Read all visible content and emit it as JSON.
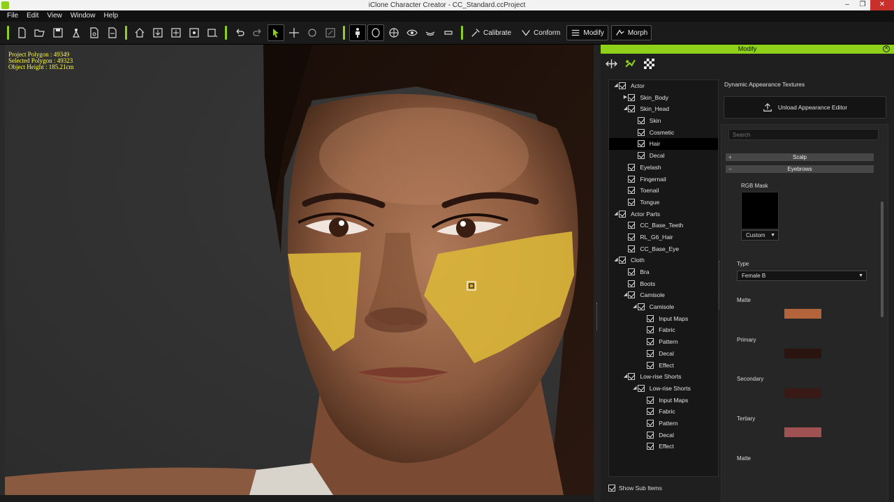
{
  "window": {
    "title": "iClone Character Creator - CC_Standard.ccProject"
  },
  "menu": [
    "File",
    "Edit",
    "View",
    "Window",
    "Help"
  ],
  "toolbar": {
    "calibrate": "Calibrate",
    "conform": "Conform",
    "modify": "Modify",
    "morph": "Morph"
  },
  "viewport": {
    "project_polygon": "Project Polygon : 49349",
    "selected_polygon": "Selected Polygon : 49323",
    "object_height": "Object Height : 185.21cm"
  },
  "panel": {
    "title": "Modify",
    "tree": [
      {
        "label": "Actor",
        "level": 0,
        "arrow": "open",
        "checked": true
      },
      {
        "label": "Skin_Body",
        "level": 1,
        "arrow": "closed",
        "checked": true
      },
      {
        "label": "Skin_Head",
        "level": 1,
        "arrow": "open",
        "checked": true
      },
      {
        "label": "Skin",
        "level": 2,
        "arrow": "",
        "checked": true
      },
      {
        "label": "Cosmetic",
        "level": 2,
        "arrow": "",
        "checked": true
      },
      {
        "label": "Hair",
        "level": 2,
        "arrow": "",
        "checked": true,
        "selected": true
      },
      {
        "label": "Decal",
        "level": 2,
        "arrow": "",
        "checked": true
      },
      {
        "label": "Eyelash",
        "level": 1,
        "arrow": "",
        "checked": true
      },
      {
        "label": "Fingernail",
        "level": 1,
        "arrow": "",
        "checked": true
      },
      {
        "label": "Toenail",
        "level": 1,
        "arrow": "",
        "checked": true
      },
      {
        "label": "Tongue",
        "level": 1,
        "arrow": "",
        "checked": true
      },
      {
        "label": "Actor Parts",
        "level": 0,
        "arrow": "open",
        "checked": true
      },
      {
        "label": "CC_Base_Teeth",
        "level": 1,
        "arrow": "",
        "checked": true
      },
      {
        "label": "RL_G6_Hair",
        "level": 1,
        "arrow": "",
        "checked": true
      },
      {
        "label": "CC_Base_Eye",
        "level": 1,
        "arrow": "",
        "checked": true
      },
      {
        "label": "Cloth",
        "level": 0,
        "arrow": "open",
        "checked": true
      },
      {
        "label": "Bra",
        "level": 1,
        "arrow": "",
        "checked": true
      },
      {
        "label": "Boots",
        "level": 1,
        "arrow": "",
        "checked": true
      },
      {
        "label": "Camisole",
        "level": 1,
        "arrow": "open",
        "checked": true
      },
      {
        "label": "Camisole",
        "level": 2,
        "arrow": "open",
        "checked": true
      },
      {
        "label": "Input Maps",
        "level": 3,
        "arrow": "",
        "checked": true
      },
      {
        "label": "Fabric",
        "level": 3,
        "arrow": "",
        "checked": true
      },
      {
        "label": "Pattern",
        "level": 3,
        "arrow": "",
        "checked": true
      },
      {
        "label": "Decal",
        "level": 3,
        "arrow": "",
        "checked": true
      },
      {
        "label": "Effect",
        "level": 3,
        "arrow": "",
        "checked": true
      },
      {
        "label": "Low-rise Shorts",
        "level": 1,
        "arrow": "open",
        "checked": true
      },
      {
        "label": "Low-rise Shorts",
        "level": 2,
        "arrow": "open",
        "checked": true
      },
      {
        "label": "Input Maps",
        "level": 3,
        "arrow": "",
        "checked": true
      },
      {
        "label": "Fabric",
        "level": 3,
        "arrow": "",
        "checked": true
      },
      {
        "label": "Pattern",
        "level": 3,
        "arrow": "",
        "checked": true
      },
      {
        "label": "Decal",
        "level": 3,
        "arrow": "",
        "checked": true
      },
      {
        "label": "Effect",
        "level": 3,
        "arrow": "",
        "checked": true
      }
    ],
    "show_sub_items": "Show Sub Items",
    "dynamic_title": "Dynamic Appearance Textures",
    "unload_button": "Unload Appearance Editor",
    "search_placeholder": "Search",
    "scalp": {
      "sign": "+",
      "label": "Scalp"
    },
    "eyebrows": {
      "sign": "−",
      "label": "Eyebrows"
    },
    "rgb_mask": "RGB Mask",
    "mask_mode": "Custom",
    "type_label": "Type",
    "type_value": "Female B",
    "colors": [
      {
        "label": "Matte",
        "hex": "#b3643a"
      },
      {
        "label": "Primary",
        "hex": "#2a1410"
      },
      {
        "label": "Secondary",
        "hex": "#3a1a16"
      },
      {
        "label": "Tertiary",
        "hex": "#a05252"
      },
      {
        "label": "Matte"
      }
    ]
  }
}
